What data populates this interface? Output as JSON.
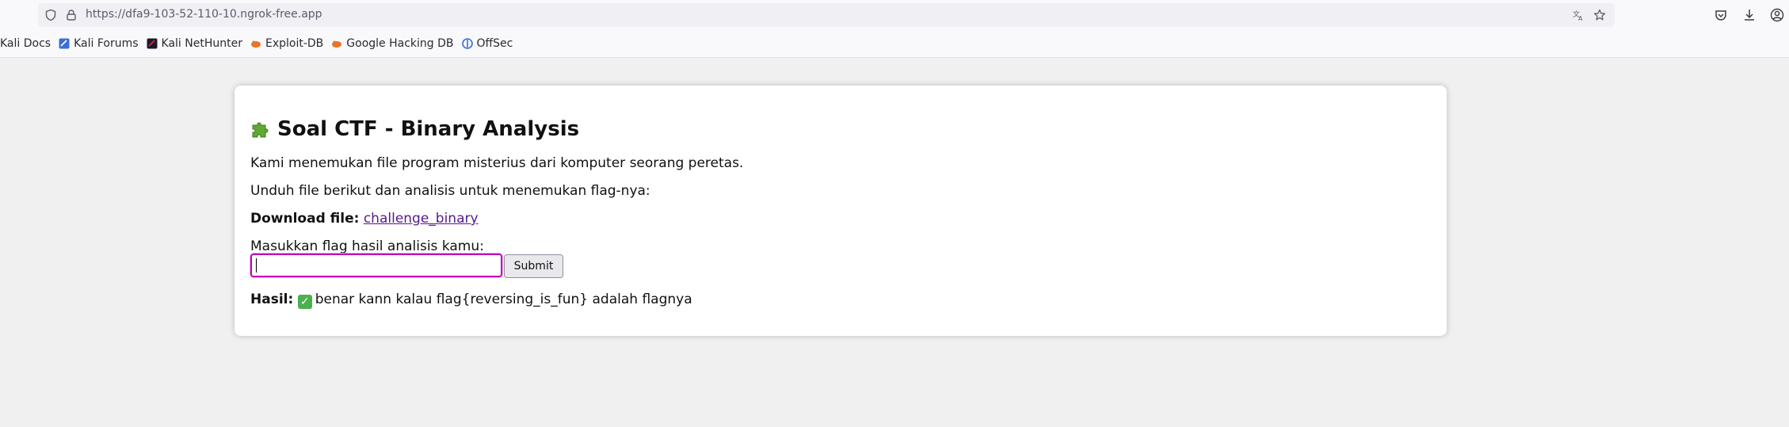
{
  "browser": {
    "url": "https://dfa9-103-52-110-10.ngrok-free.app",
    "bookmarks": [
      {
        "label": "Kali Docs",
        "icon": "kali-docs-icon"
      },
      {
        "label": "Kali Forums",
        "icon": "kali-forums-icon"
      },
      {
        "label": "Kali NetHunter",
        "icon": "kali-nethunter-icon"
      },
      {
        "label": "Exploit-DB",
        "icon": "exploit-db-icon"
      },
      {
        "label": "Google Hacking DB",
        "icon": "ghdb-icon"
      },
      {
        "label": "OffSec",
        "icon": "offsec-icon"
      }
    ]
  },
  "page": {
    "title": "Soal CTF - Binary Analysis",
    "intro": "Kami menemukan file program misterius dari komputer seorang peretas.",
    "instruction": "Unduh file berikut dan analisis untuk menemukan flag-nya:",
    "download_label": "Download file:",
    "download_link": "challenge_binary",
    "input_label": "Masukkan flag hasil analisis kamu:",
    "input_value": "",
    "submit_label": "Submit",
    "result_label": "Hasil:",
    "result_text": "benar kann kalau flag{reversing_is_fun} adalah flagnya",
    "accent": "#c000c0"
  }
}
